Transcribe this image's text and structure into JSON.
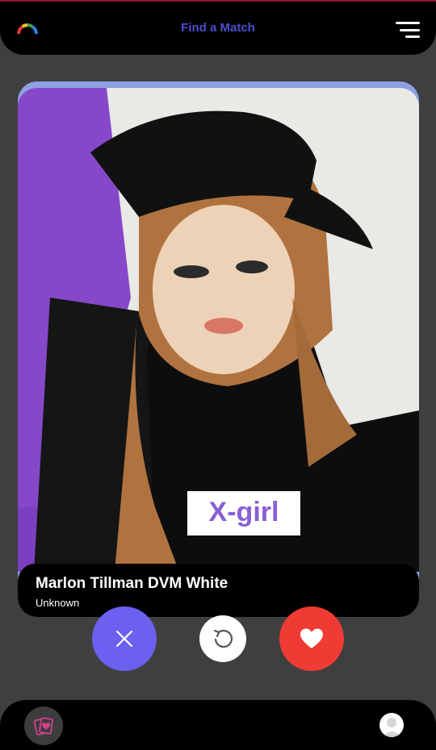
{
  "header": {
    "title": "Find a Match",
    "logo_icon": "rainbow-arc-icon",
    "menu_icon": "menu-lines-icon"
  },
  "profile": {
    "name": "Marlon Tillman DVM White",
    "subtitle": "Unknown",
    "photo_desc_icon": "profile-photo"
  },
  "actions": {
    "dislike_icon": "close-icon",
    "undo_icon": "undo-icon",
    "like_icon": "heart-icon"
  },
  "bottom_nav": {
    "cards_icon": "cards-heart-icon",
    "profile_icon": "avatar-icon"
  },
  "colors": {
    "background": "#3f3f3f",
    "bar": "#000000",
    "title": "#4b4fd0",
    "dislike": "#6b60f0",
    "like": "#ef3b33",
    "card_accent": "#8ea0e2"
  }
}
